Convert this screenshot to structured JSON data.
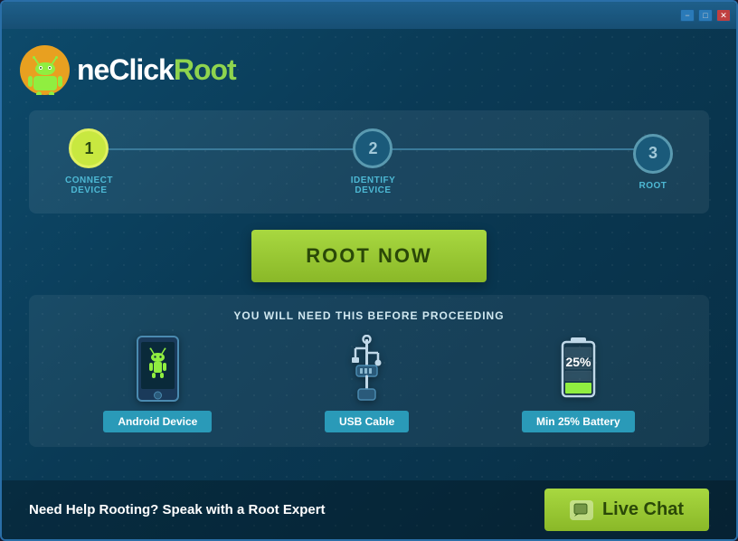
{
  "window": {
    "title": "OneClickRoot",
    "controls": {
      "minimize": "−",
      "maximize": "□",
      "close": "✕"
    }
  },
  "logo": {
    "text_one": "ne",
    "text_click": "Click",
    "text_root": "Root"
  },
  "steps": [
    {
      "number": "1",
      "label": "CONNECT\nDEVICE",
      "active": true
    },
    {
      "number": "2",
      "label": "IDENTIFY\nDEVICE",
      "active": false
    },
    {
      "number": "3",
      "label": "ROOT",
      "active": false
    }
  ],
  "root_button": {
    "label": "ROOT NOW"
  },
  "prereq": {
    "title": "YOU WILL NEED THIS BEFORE PROCEEDING",
    "items": [
      {
        "label": "Android Device",
        "icon": "android-device-icon"
      },
      {
        "label": "USB Cable",
        "icon": "usb-cable-icon"
      },
      {
        "label": "Min 25% Battery",
        "icon": "battery-icon"
      }
    ]
  },
  "footer": {
    "help_text": "Need Help Rooting? Speak with a Root Expert",
    "live_chat_label": "Live Chat"
  }
}
